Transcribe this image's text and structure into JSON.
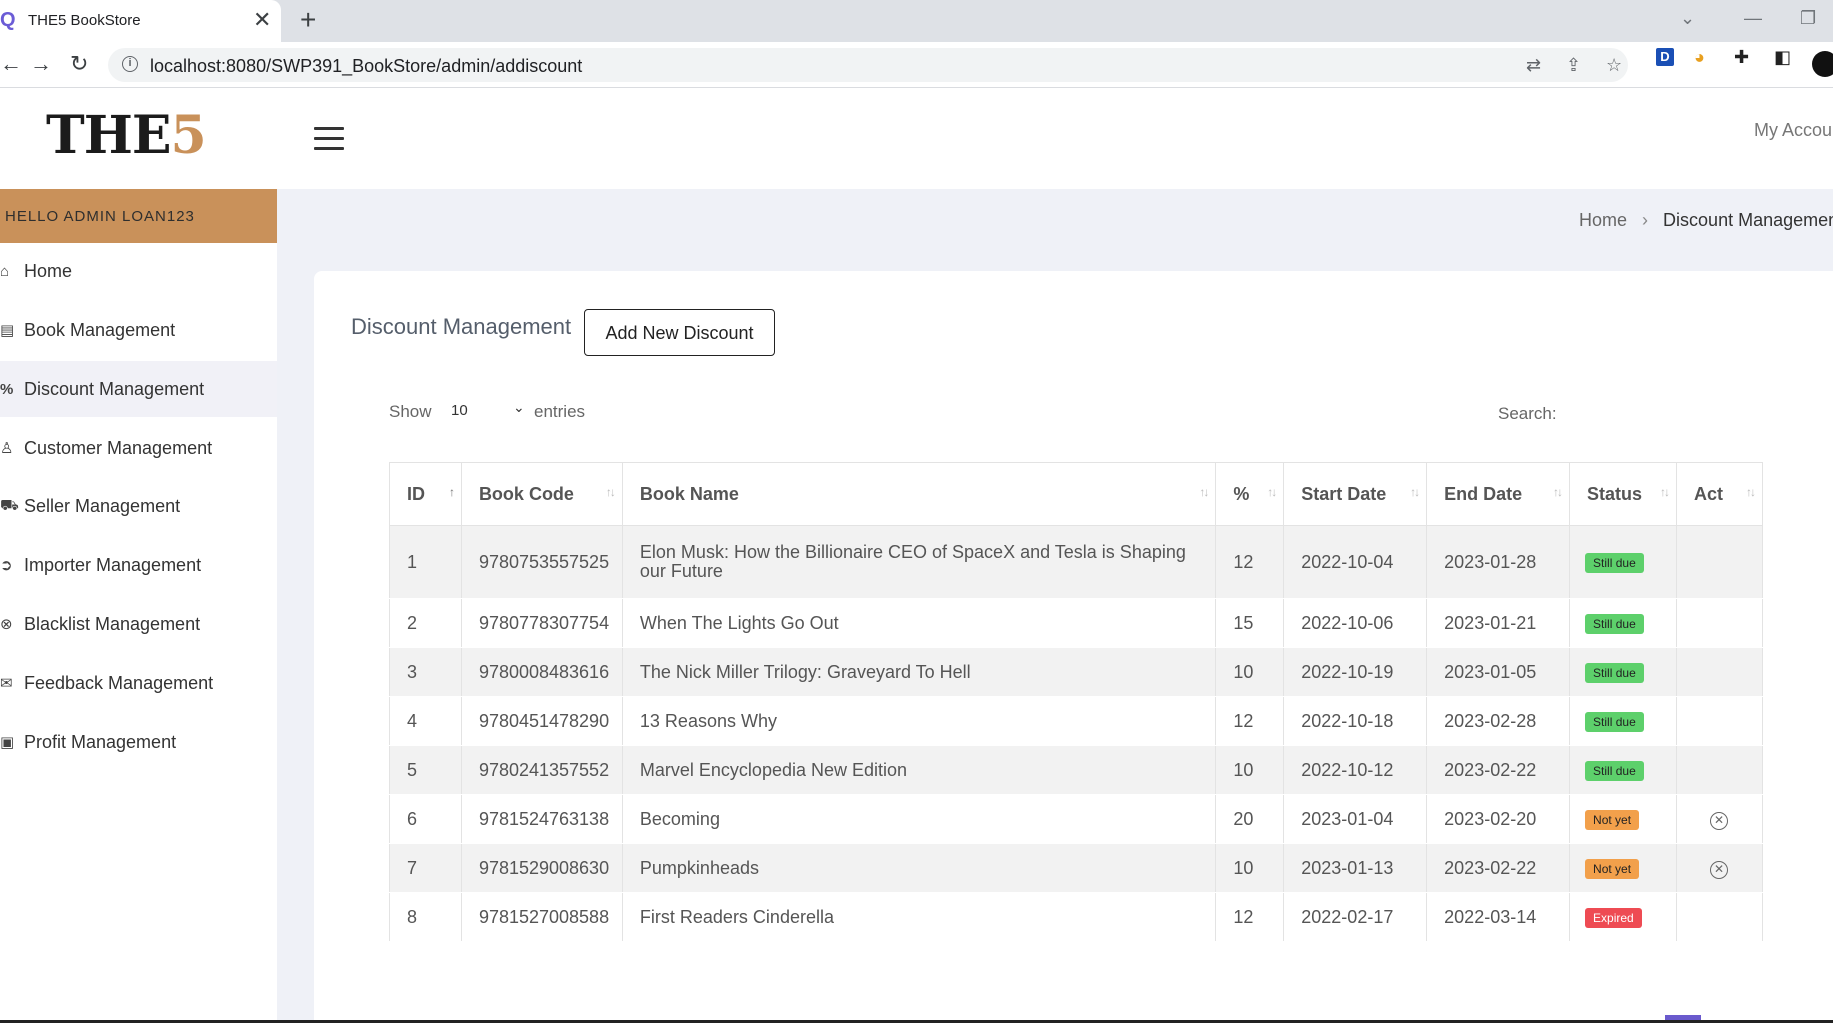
{
  "browser": {
    "tab_title": "THE5 BookStore",
    "tab_close": "✕",
    "new_tab": "+",
    "url": "localhost:8080/SWP391_BookStore/admin/addiscount"
  },
  "header": {
    "logo_main": "THE",
    "logo_accent": "5",
    "account_label": "My Accou"
  },
  "sidebar": {
    "greeting": "HELLO ADMIN LOAN123",
    "items": [
      {
        "label": "Home",
        "icon": "home-icon",
        "glyph": "⌂"
      },
      {
        "label": "Book Management",
        "icon": "book-icon",
        "glyph": "▤"
      },
      {
        "label": "Discount Management",
        "icon": "percent-icon",
        "glyph": "%"
      },
      {
        "label": "Customer Management",
        "icon": "user-icon",
        "glyph": "♙"
      },
      {
        "label": "Seller Management",
        "icon": "cart-icon",
        "glyph": "⛟"
      },
      {
        "label": "Importer Management",
        "icon": "import-icon",
        "glyph": "➲"
      },
      {
        "label": "Blacklist Management",
        "icon": "block-icon",
        "glyph": "⊗"
      },
      {
        "label": "Feedback Management",
        "icon": "mail-icon",
        "glyph": "✉"
      },
      {
        "label": "Profit Management",
        "icon": "money-icon",
        "glyph": "▣"
      }
    ]
  },
  "breadcrumb": {
    "home": "Home",
    "separator": "›",
    "current": "Discount Management"
  },
  "card": {
    "title": "Discount Management",
    "add_button": "Add New Discount",
    "show_label": "Show",
    "entries_value": "10",
    "entries_label": "entries",
    "search_label": "Search:"
  },
  "table": {
    "columns": [
      "ID",
      "Book Code",
      "Book Name",
      "%",
      "Start Date",
      "End Date",
      "Status",
      "Act"
    ],
    "rows": [
      {
        "id": "1",
        "code": "9780753557525",
        "name": "Elon Musk: How the Billionaire CEO of SpaceX and Tesla is Shaping our Future",
        "pct": "12",
        "start": "2022-10-04",
        "end": "2023-01-28",
        "status": "Still due",
        "status_type": "still",
        "act": false
      },
      {
        "id": "2",
        "code": "9780778307754",
        "name": "When The Lights Go Out",
        "pct": "15",
        "start": "2022-10-06",
        "end": "2023-01-21",
        "status": "Still due",
        "status_type": "still",
        "act": false
      },
      {
        "id": "3",
        "code": "9780008483616",
        "name": "The Nick Miller Trilogy: Graveyard To Hell",
        "pct": "10",
        "start": "2022-10-19",
        "end": "2023-01-05",
        "status": "Still due",
        "status_type": "still",
        "act": false
      },
      {
        "id": "4",
        "code": "9780451478290",
        "name": "13 Reasons Why",
        "pct": "12",
        "start": "2022-10-18",
        "end": "2023-02-28",
        "status": "Still due",
        "status_type": "still",
        "act": false
      },
      {
        "id": "5",
        "code": "9780241357552",
        "name": "Marvel Encyclopedia New Edition",
        "pct": "10",
        "start": "2022-10-12",
        "end": "2023-02-22",
        "status": "Still due",
        "status_type": "still",
        "act": false
      },
      {
        "id": "6",
        "code": "9781524763138",
        "name": "Becoming",
        "pct": "20",
        "start": "2023-01-04",
        "end": "2023-02-20",
        "status": "Not yet",
        "status_type": "notyet",
        "act": true
      },
      {
        "id": "7",
        "code": "9781529008630",
        "name": "Pumpkinheads",
        "pct": "10",
        "start": "2023-01-13",
        "end": "2023-02-22",
        "status": "Not yet",
        "status_type": "notyet",
        "act": true
      },
      {
        "id": "8",
        "code": "9781527008588",
        "name": "First Readers Cinderella",
        "pct": "12",
        "start": "2022-02-17",
        "end": "2022-03-14",
        "status": "Expired",
        "status_type": "expired",
        "act": false
      }
    ]
  },
  "colors": {
    "accent": "#c9915a",
    "still_due": "#5dd06b",
    "not_yet": "#f2a04b",
    "expired": "#ee4b53",
    "content_bg": "#eff1f7"
  }
}
